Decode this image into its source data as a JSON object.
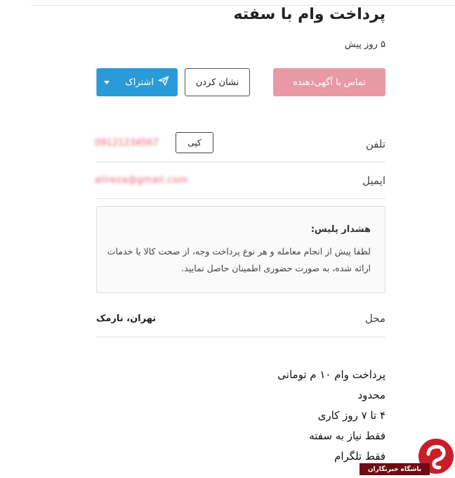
{
  "ad": {
    "title": "پرداخت وام با سفته",
    "time_ago": "۵ روز پیش"
  },
  "actions": {
    "contact_label": "تماس با آگهی‌دهنده",
    "show_label": "نشان کردن",
    "share_label": "اشتراک"
  },
  "phone": {
    "label": "تلفن",
    "value": "09121234567",
    "copy_label": "کپی"
  },
  "email": {
    "label": "ایمیل",
    "value": "alireza@gmail.com"
  },
  "warning": {
    "title": "هشدار پلیس:",
    "body": "لطفا پیش از انجام معامله و هر نوع پرداخت وجه، از صحت کالا یا خدمات ارائه شده، به صورت حضوری اطمینان حاصل نمایید."
  },
  "location": {
    "label": "محل",
    "value": "تهران، نارمک"
  },
  "description": [
    "پرداخت وام ۱۰ م تومانی",
    "محدود",
    "۴ تا ۷ روز کاری",
    "فقط نیاز به سفته",
    "فقط تلگرام"
  ],
  "watermark": {
    "text": "باشگاه خبرنگاران"
  },
  "colors": {
    "contact_button": "#e79aa3",
    "share_button": "#2b9ad8",
    "watermark_red": "#c61f2a"
  },
  "icons": {
    "share": "paper-plane-icon",
    "dropdown": "chevron-down-icon"
  }
}
